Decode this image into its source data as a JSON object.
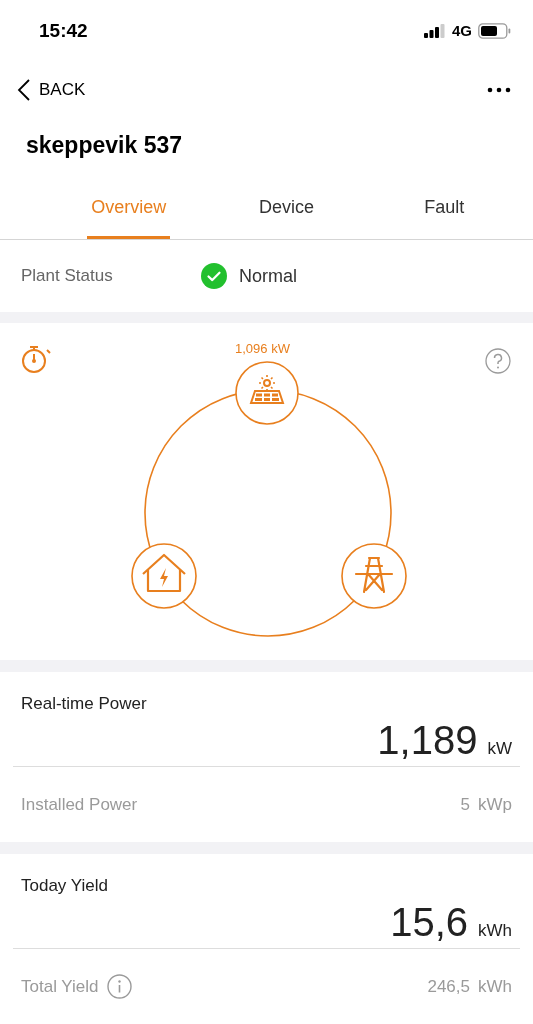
{
  "status_bar": {
    "time": "15:42",
    "network": "4G"
  },
  "nav": {
    "back": "BACK",
    "title": "skeppevik 537"
  },
  "tabs": [
    {
      "label": "Overview",
      "selected": true
    },
    {
      "label": "Device",
      "selected": false
    },
    {
      "label": "Fault",
      "selected": false
    }
  ],
  "plant_status": {
    "label": "Plant Status",
    "value": "Normal",
    "kind": "normal"
  },
  "flow": {
    "solar_power": "1,096 kW"
  },
  "cards": [
    {
      "title": "Real-time Power",
      "value": "1,189",
      "unit": "kW",
      "detail": {
        "label": "Installed Power",
        "info": false,
        "value": "5",
        "unit": "kWp"
      }
    },
    {
      "title": "Today Yield",
      "value": "15,6",
      "unit": "kWh",
      "detail": {
        "label": "Total Yield",
        "info": true,
        "value": "246,5",
        "unit": "kWh"
      }
    }
  ]
}
